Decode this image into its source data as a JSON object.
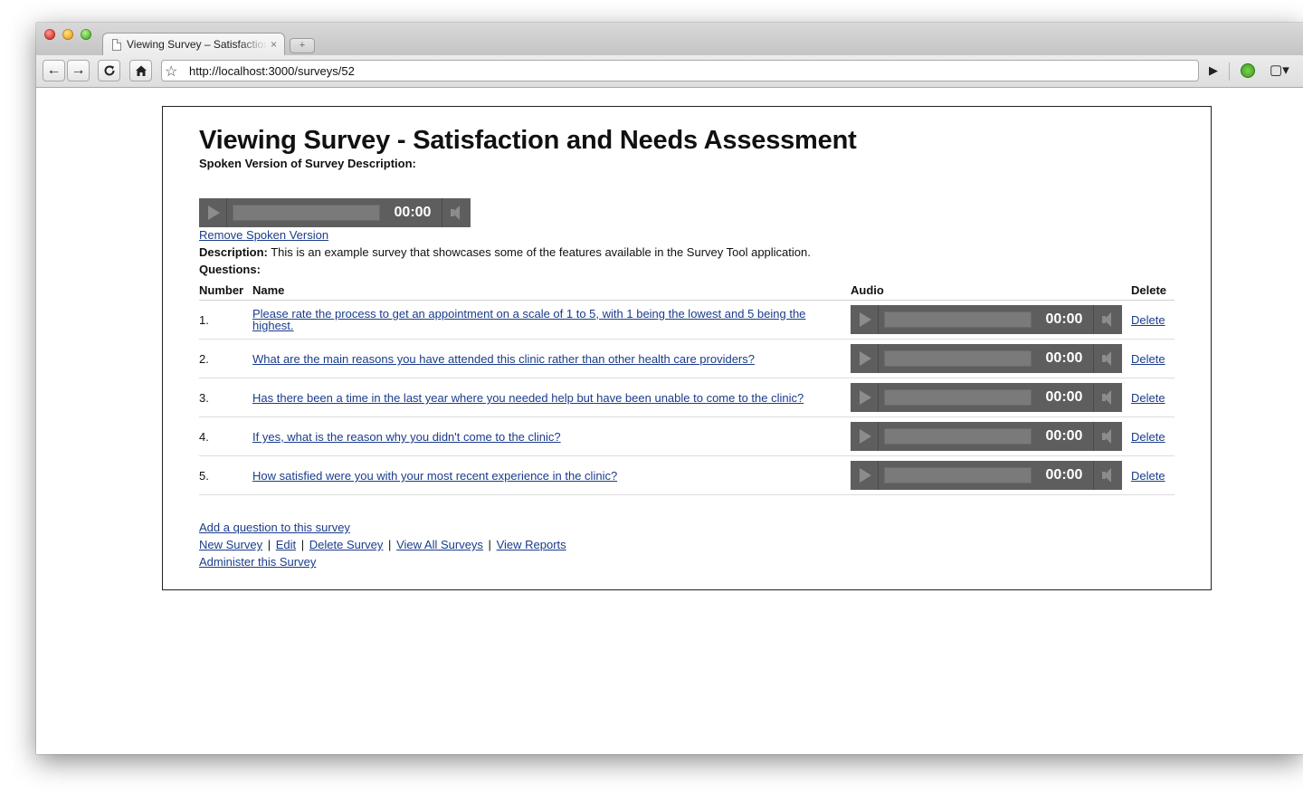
{
  "browser": {
    "tab_title": "Viewing Survey – Satisfaction and Needs Assessment",
    "tab_close": "×",
    "new_tab": "+",
    "url": "http://localhost:3000/surveys/52",
    "back": "←",
    "forward": "→",
    "star": "☆",
    "go": "▶",
    "page_menu": "▾"
  },
  "page": {
    "title": "Viewing Survey - Satisfaction and Needs Assessment",
    "spoken_label": "Spoken Version of Survey Description:",
    "description_player": {
      "time": "00:00",
      "progress": 0
    },
    "remove_spoken": "Remove Spoken Version",
    "description_label": "Description:",
    "description_text": " This is an example survey that showcases some of the features available in the Survey Tool application.",
    "questions_label": "Questions:"
  },
  "table": {
    "headers": {
      "number": "Number",
      "name": "Name",
      "audio": "Audio",
      "delete": "Delete"
    },
    "rows": [
      {
        "number": "1.",
        "name": "Please rate the process to get an appointment on a scale of 1 to 5, with 1 being the lowest and 5 being the highest.",
        "time": "00:00",
        "delete": "Delete"
      },
      {
        "number": "2.",
        "name": "What are the main reasons you have attended this clinic rather than other health care providers?",
        "time": "00:00",
        "delete": "Delete"
      },
      {
        "number": "3.",
        "name": "Has there been a time in the last year where you needed help but have been unable to come to the clinic?",
        "time": "00:00",
        "delete": "Delete"
      },
      {
        "number": "4.",
        "name": "If yes, what is the reason why you didn't come to the clinic?",
        "time": "00:00",
        "delete": "Delete"
      },
      {
        "number": "5.",
        "name": "How satisfied were you with your most recent experience in the clinic?",
        "time": "00:00",
        "delete": "Delete"
      }
    ]
  },
  "footer": {
    "add_question": "Add a question to this survey",
    "new_survey": "New Survey",
    "edit": "Edit",
    "delete_survey": "Delete Survey",
    "view_all": "View All Surveys",
    "view_reports": "View Reports",
    "administer": "Administer this Survey",
    "separator": "|"
  },
  "colors": {
    "link": "#1a3c8c",
    "player_bg": "#5e5e5e"
  }
}
